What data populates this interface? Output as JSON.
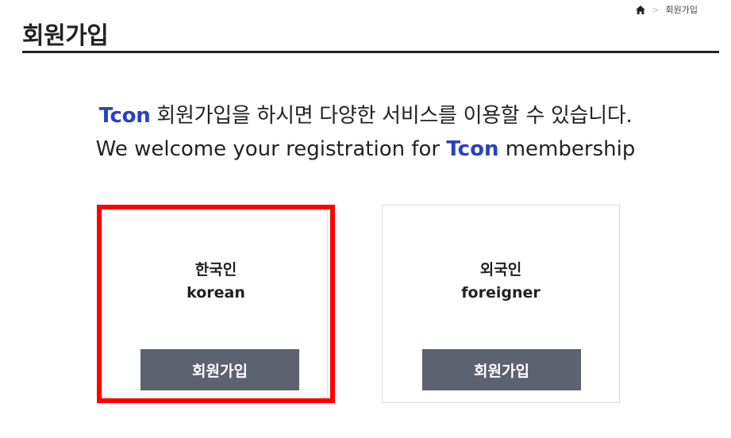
{
  "breadcrumb": {
    "home_icon": "home-icon",
    "separator": ">",
    "current": "회원가입"
  },
  "page": {
    "title": "회원가입"
  },
  "welcome": {
    "brand": "Tcon",
    "ko_rest": "회원가입을 하시면 다양한 서비스를 이용할 수 있습니다.",
    "en_before": "We welcome your registration for",
    "en_after": "membership",
    "brand_color": "#2840c6"
  },
  "cards": [
    {
      "ko_label": "한국인",
      "en_label": "korean",
      "button_label": "회원가입",
      "highlight_color": "#ff0000"
    },
    {
      "ko_label": "외국인",
      "en_label": "foreigner",
      "button_label": "회원가입"
    }
  ],
  "colors": {
    "button_bg": "#5d6270"
  }
}
